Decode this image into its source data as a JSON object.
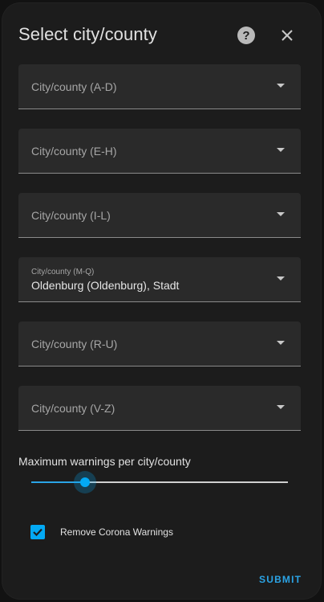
{
  "dialog": {
    "title": "Select city/county",
    "help_icon": "help-circle-icon",
    "close_icon": "close-icon"
  },
  "fields": [
    {
      "label": "City/county (A-D)",
      "value": ""
    },
    {
      "label": "City/county (E-H)",
      "value": ""
    },
    {
      "label": "City/county (I-L)",
      "value": ""
    },
    {
      "label": "City/county (M-Q)",
      "value": "Oldenburg (Oldenburg), Stadt"
    },
    {
      "label": "City/county (R-U)",
      "value": ""
    },
    {
      "label": "City/county (V-Z)",
      "value": ""
    }
  ],
  "slider": {
    "label": "Maximum warnings per city/county",
    "fraction": 0.21
  },
  "checkbox": {
    "label": "Remove Corona Warnings",
    "checked": true
  },
  "submit_label": "SUBMIT",
  "colors": {
    "accent": "#03a9f4",
    "dialog_bg": "#1c1c1c",
    "field_bg": "#2a2a2a"
  }
}
